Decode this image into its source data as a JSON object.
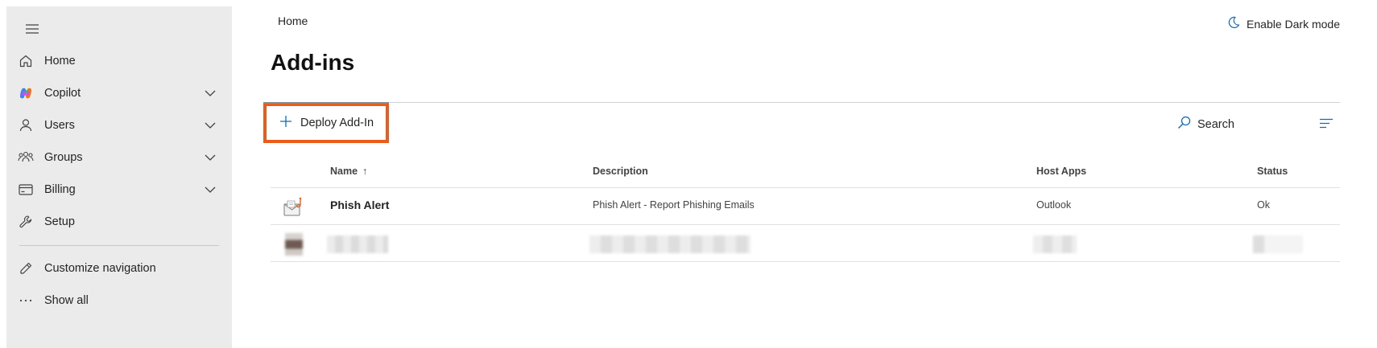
{
  "sidebar": {
    "items": [
      {
        "label": "Home"
      },
      {
        "label": "Copilot"
      },
      {
        "label": "Users"
      },
      {
        "label": "Groups"
      },
      {
        "label": "Billing"
      },
      {
        "label": "Setup"
      },
      {
        "label": "Customize navigation"
      },
      {
        "label": "Show all"
      }
    ]
  },
  "header": {
    "breadcrumb": "Home",
    "dark_mode_label": "Enable Dark mode",
    "title": "Add-ins"
  },
  "toolbar": {
    "deploy_label": "Deploy Add-In",
    "search_label": "Search"
  },
  "table": {
    "columns": [
      "Name",
      "Description",
      "Host Apps",
      "Status"
    ],
    "sort_indicator": "↑",
    "rows": [
      {
        "name": "Phish Alert",
        "description": "Phish Alert - Report Phishing Emails",
        "host_apps": "Outlook",
        "status": "Ok"
      }
    ]
  },
  "colors": {
    "accent": "#0f6cbd",
    "highlight": "#eb5c1a",
    "sidebar_bg": "#ebebeb"
  }
}
